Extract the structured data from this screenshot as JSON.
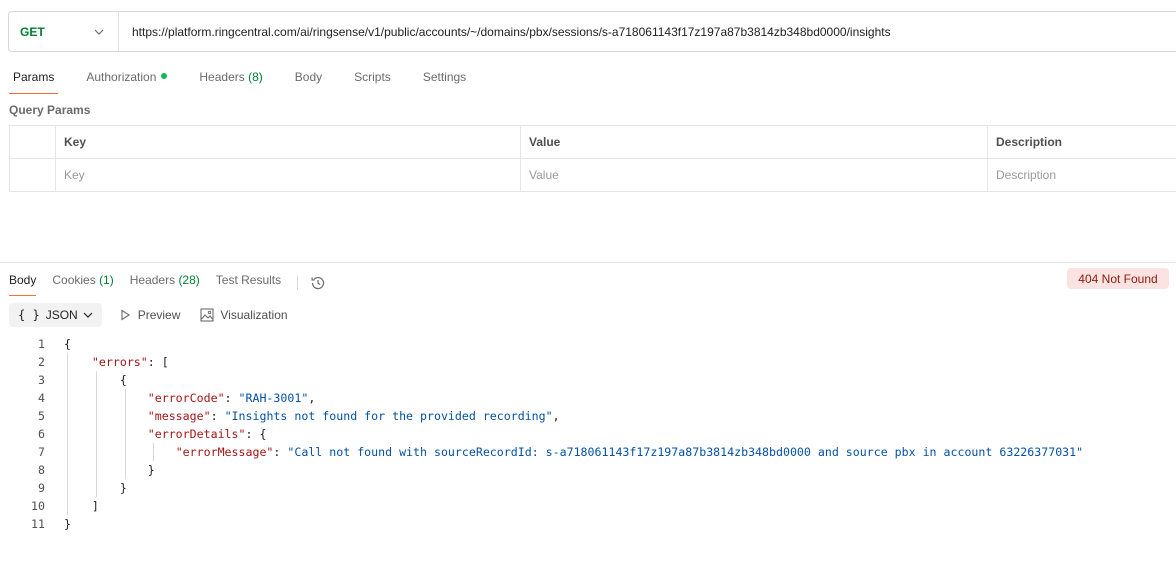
{
  "request": {
    "method": "GET",
    "url": "https://platform.ringcentral.com/ai/ringsense/v1/public/accounts/~/domains/pbx/sessions/s-a718061143f17z197a87b3814zb348bd0000/insights"
  },
  "request_tabs": [
    {
      "label": "Params",
      "active": true
    },
    {
      "label": "Authorization",
      "dot": true
    },
    {
      "label": "Headers",
      "count": "(8)"
    },
    {
      "label": "Body"
    },
    {
      "label": "Scripts"
    },
    {
      "label": "Settings"
    }
  ],
  "query_params": {
    "title": "Query Params",
    "headers": {
      "key": "Key",
      "value": "Value",
      "description": "Description"
    },
    "placeholders": {
      "key": "Key",
      "value": "Value",
      "description": "Description"
    }
  },
  "response_tabs": [
    {
      "label": "Body",
      "active": true
    },
    {
      "label": "Cookies",
      "count": "(1)"
    },
    {
      "label": "Headers",
      "count": "(28)"
    },
    {
      "label": "Test Results"
    }
  ],
  "response_status": "404 Not Found",
  "body_toolbar": {
    "format_braces": "{ }",
    "format": "JSON",
    "preview": "Preview",
    "visualization": "Visualization"
  },
  "code_lines": [
    {
      "n": "1",
      "parts": [
        {
          "t": "{",
          "c": "p"
        }
      ]
    },
    {
      "n": "2",
      "parts": [
        {
          "t": "    ",
          "c": "p"
        },
        {
          "t": "\"errors\"",
          "c": "k"
        },
        {
          "t": ": [",
          "c": "p"
        }
      ]
    },
    {
      "n": "3",
      "parts": [
        {
          "t": "        {",
          "c": "p"
        }
      ]
    },
    {
      "n": "4",
      "parts": [
        {
          "t": "            ",
          "c": "p"
        },
        {
          "t": "\"errorCode\"",
          "c": "k"
        },
        {
          "t": ": ",
          "c": "p"
        },
        {
          "t": "\"RAH-3001\"",
          "c": "s"
        },
        {
          "t": ",",
          "c": "p"
        }
      ]
    },
    {
      "n": "5",
      "parts": [
        {
          "t": "            ",
          "c": "p"
        },
        {
          "t": "\"message\"",
          "c": "k"
        },
        {
          "t": ": ",
          "c": "p"
        },
        {
          "t": "\"Insights not found for the provided recording\"",
          "c": "s"
        },
        {
          "t": ",",
          "c": "p"
        }
      ]
    },
    {
      "n": "6",
      "parts": [
        {
          "t": "            ",
          "c": "p"
        },
        {
          "t": "\"errorDetails\"",
          "c": "k"
        },
        {
          "t": ": {",
          "c": "p"
        }
      ]
    },
    {
      "n": "7",
      "parts": [
        {
          "t": "                ",
          "c": "p"
        },
        {
          "t": "\"errorMessage\"",
          "c": "k"
        },
        {
          "t": ": ",
          "c": "p"
        },
        {
          "t": "\"Call not found with sourceRecordId: s-a718061143f17z197a87b3814zb348bd0000 and source pbx in account 63226377031\"",
          "c": "s"
        }
      ]
    },
    {
      "n": "8",
      "parts": [
        {
          "t": "            }",
          "c": "p"
        }
      ]
    },
    {
      "n": "9",
      "parts": [
        {
          "t": "        }",
          "c": "p"
        }
      ]
    },
    {
      "n": "10",
      "parts": [
        {
          "t": "    ]",
          "c": "p"
        }
      ]
    },
    {
      "n": "11",
      "parts": [
        {
          "t": "}",
          "c": "p"
        }
      ]
    }
  ]
}
